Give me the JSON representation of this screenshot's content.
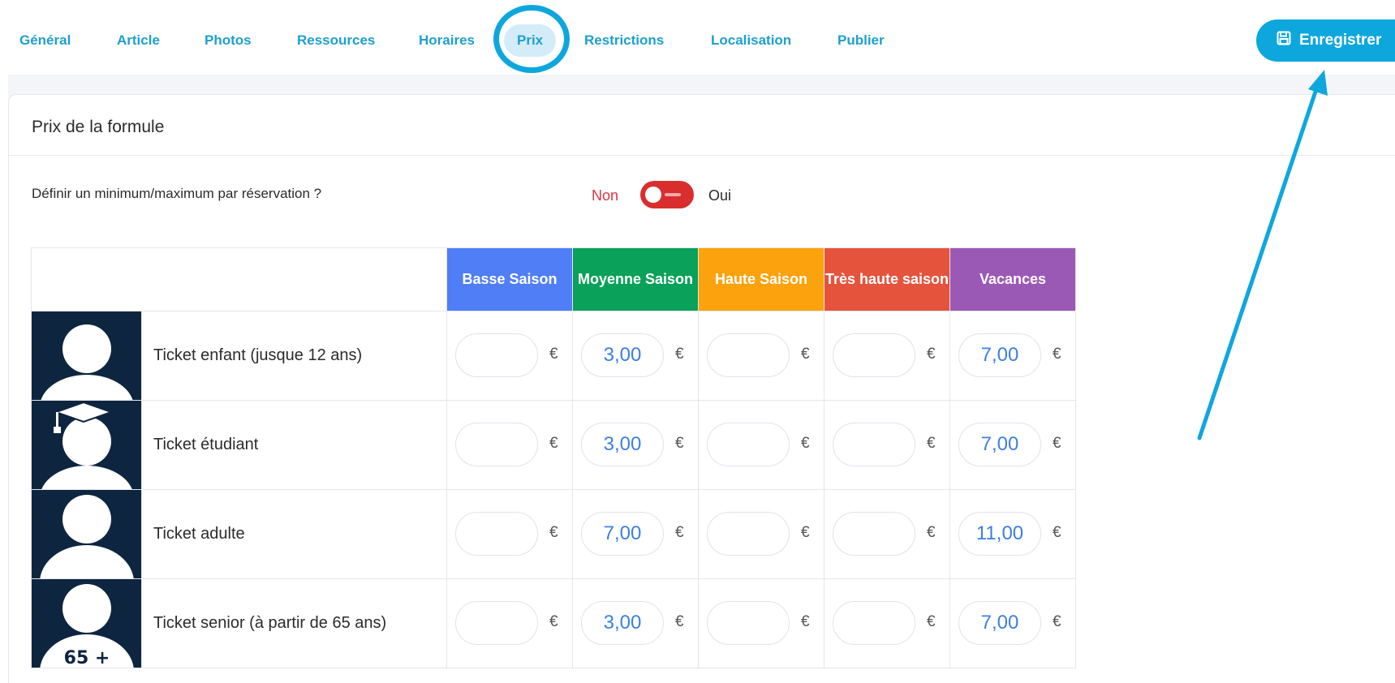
{
  "nav": {
    "tabs": [
      {
        "label": "Général"
      },
      {
        "label": "Article"
      },
      {
        "label": "Photos"
      },
      {
        "label": "Ressources"
      },
      {
        "label": "Horaires"
      },
      {
        "label": "Prix",
        "active": true
      },
      {
        "label": "Restrictions"
      },
      {
        "label": "Localisation"
      },
      {
        "label": "Publier"
      }
    ],
    "save_label": "Enregistrer",
    "save_icon": "floppy-disk-icon"
  },
  "card": {
    "title": "Prix de la formule",
    "minmax_label": "Définir un minimum/maximum par réservation ?",
    "toggle_off": "Non",
    "toggle_on": "Oui",
    "toggle_state": "off"
  },
  "seasons": [
    {
      "label": "Basse Saison",
      "color": "#4f7ef6"
    },
    {
      "label": "Moyenne Saison",
      "color": "#0aa15a"
    },
    {
      "label": "Haute Saison",
      "color": "#fca20c"
    },
    {
      "label": "Très haute saison",
      "color": "#e5533d"
    },
    {
      "label": "Vacances",
      "color": "#9b59b6"
    }
  ],
  "currency": "€",
  "tickets": [
    {
      "name": "Ticket enfant (jusque 12 ans)",
      "icon": "child-avatar-icon",
      "prices": [
        "",
        "3,00",
        "",
        "",
        "7,00"
      ]
    },
    {
      "name": "Ticket étudiant",
      "icon": "student-avatar-icon",
      "prices": [
        "",
        "3,00",
        "",
        "",
        "7,00"
      ]
    },
    {
      "name": "Ticket adulte",
      "icon": "adult-avatar-icon",
      "prices": [
        "",
        "7,00",
        "",
        "",
        "11,00"
      ]
    },
    {
      "name": "Ticket senior (à partir de 65 ans)",
      "icon": "senior-avatar-icon",
      "avatar_badge": "65 +",
      "prices": [
        "",
        "3,00",
        "",
        "",
        "7,00"
      ]
    }
  ]
}
